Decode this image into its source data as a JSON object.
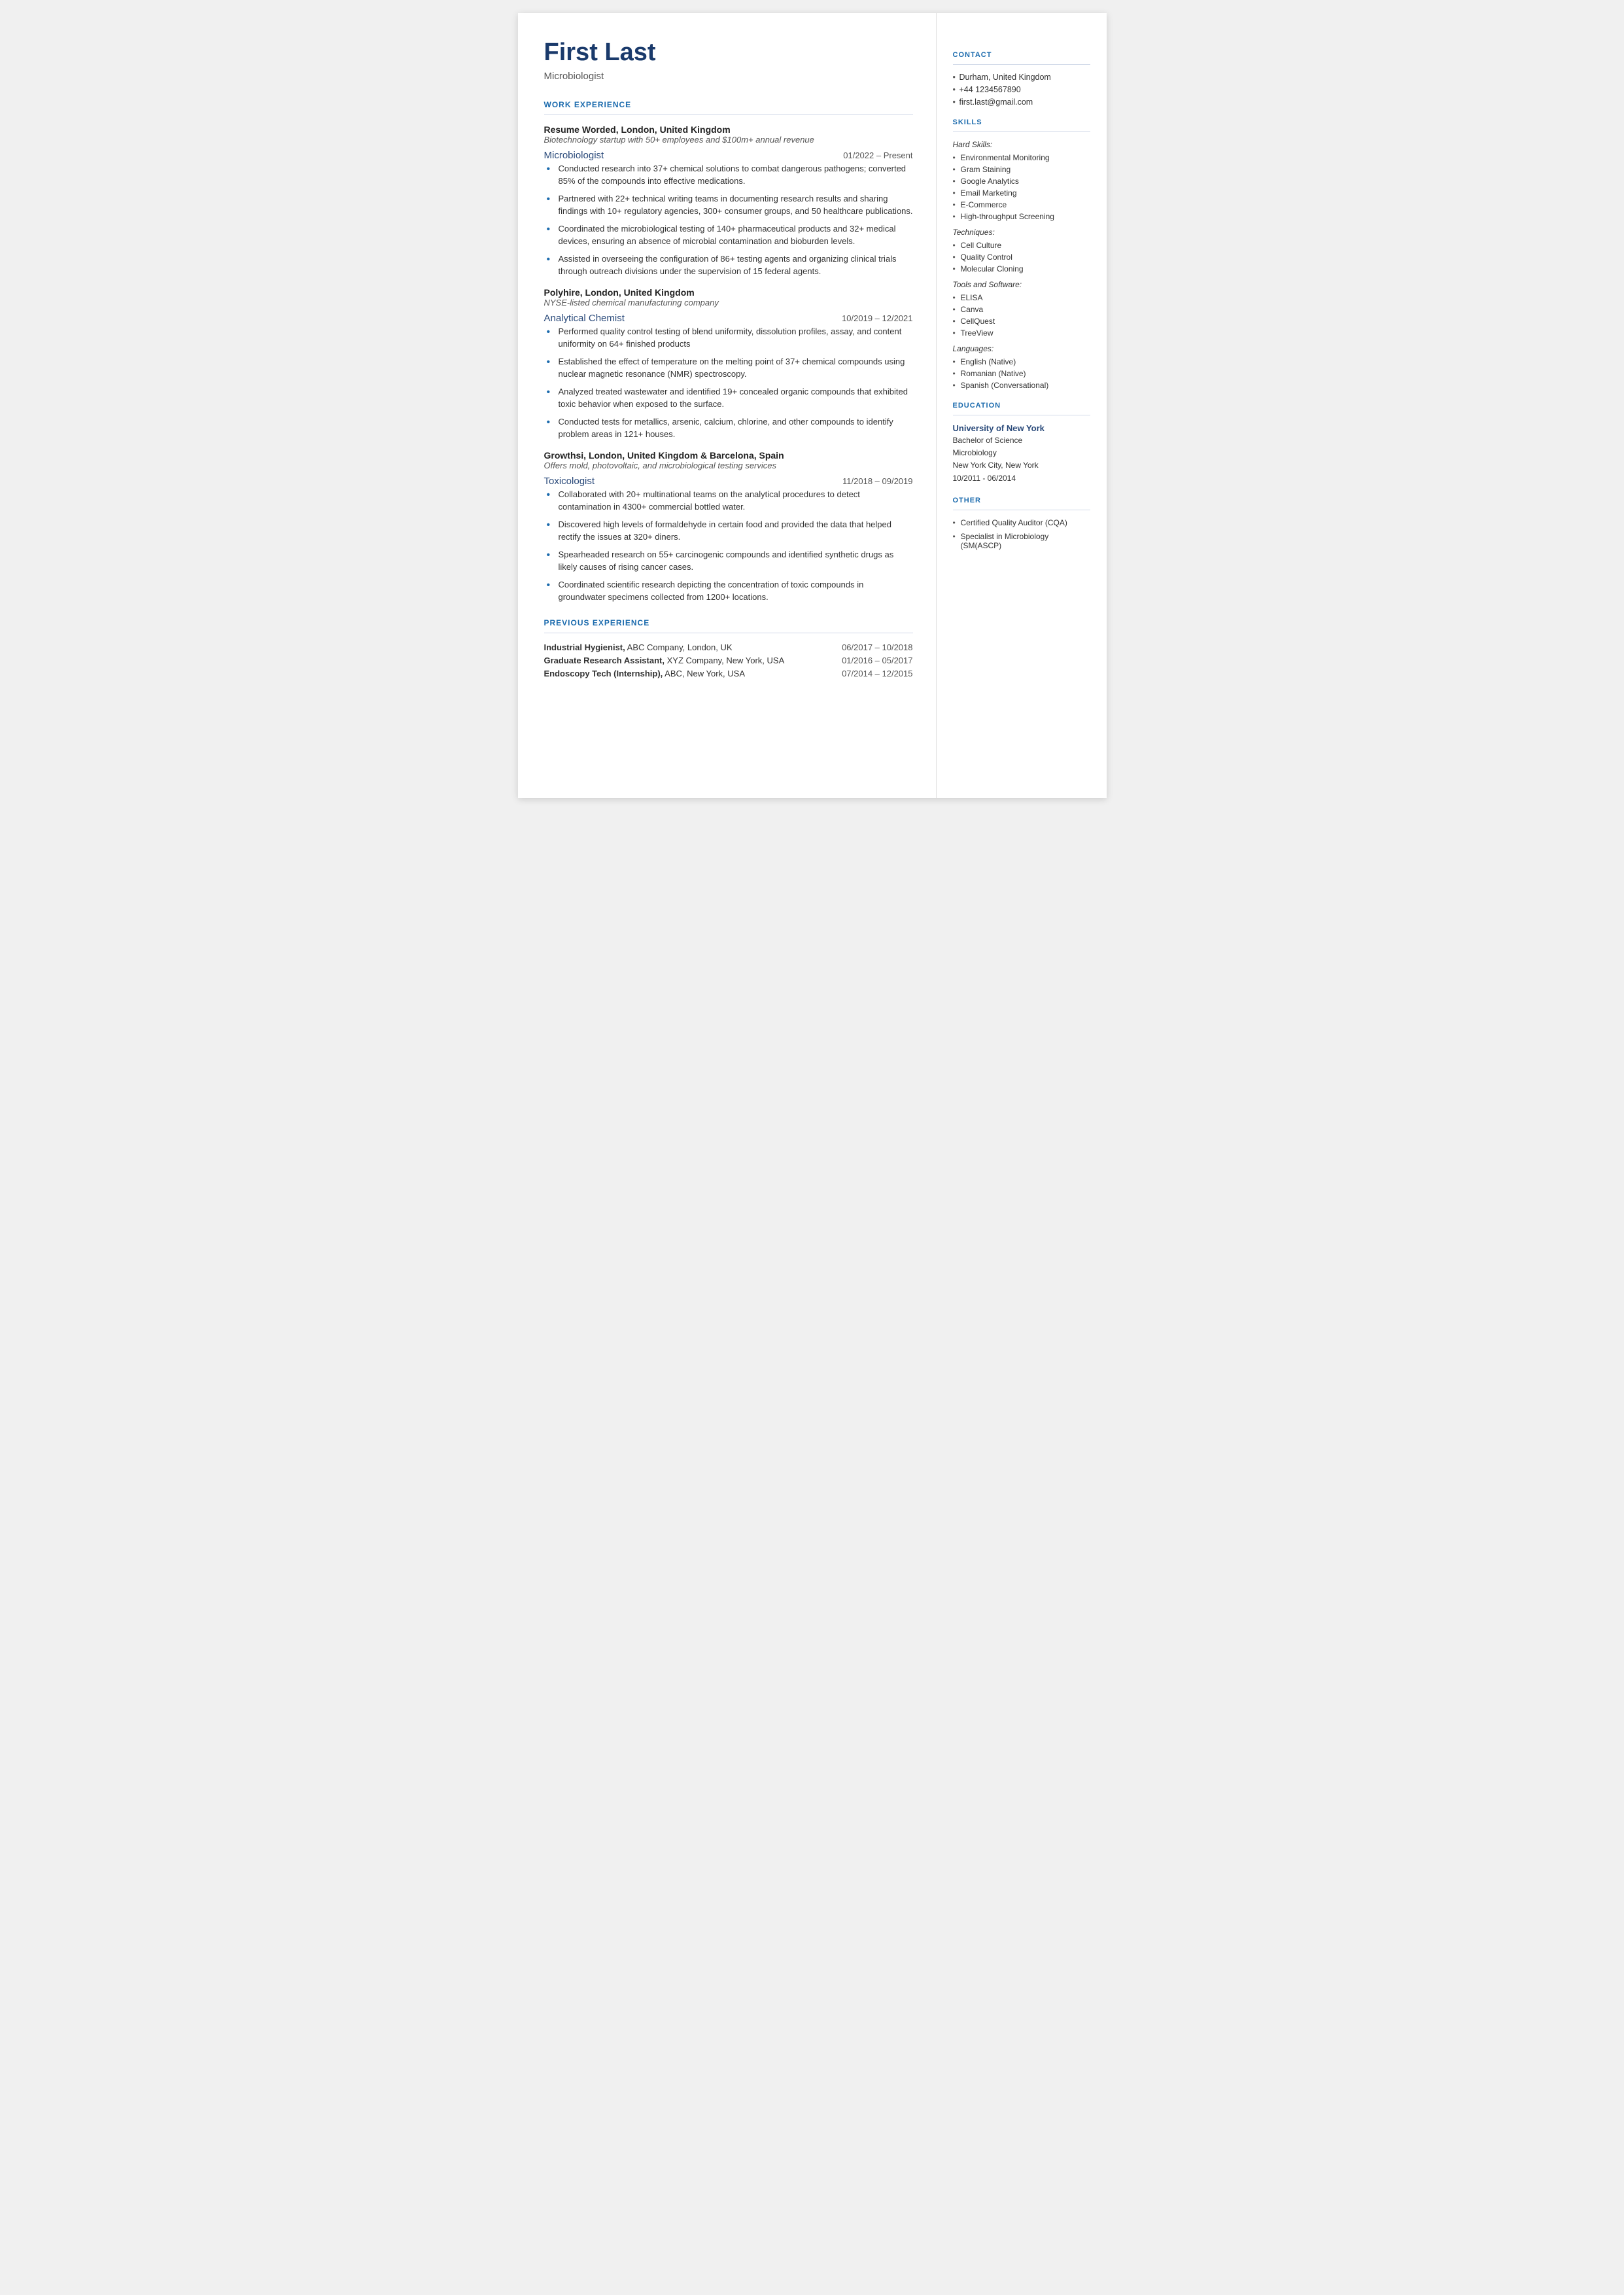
{
  "header": {
    "name": "First Last",
    "title": "Microbiologist"
  },
  "left": {
    "work_experience_heading": "WORK EXPERIENCE",
    "jobs": [
      {
        "employer": "Resume Worded,",
        "employer_suffix": " London, United Kingdom",
        "description": "Biotechnology startup with 50+ employees and $100m+ annual revenue",
        "job_title": "Microbiologist",
        "dates": "01/2022 – Present",
        "bullets": [
          "Conducted research into 37+ chemical solutions to combat dangerous pathogens; converted 85% of the compounds into effective medications.",
          "Partnered with 22+ technical writing teams in documenting research results and sharing findings with 10+ regulatory agencies, 300+ consumer groups, and 50 healthcare publications.",
          "Coordinated the microbiological testing of 140+ pharmaceutical products and 32+ medical devices, ensuring an absence of microbial contamination and bioburden levels.",
          "Assisted in overseeing the configuration of 86+ testing agents and organizing clinical trials through outreach divisions under the supervision of 15 federal agents."
        ]
      },
      {
        "employer": "Polyhire,",
        "employer_suffix": " London, United Kingdom",
        "description": "NYSE-listed chemical manufacturing company",
        "job_title": "Analytical Chemist",
        "dates": "10/2019 – 12/2021",
        "bullets": [
          "Performed quality control testing of blend uniformity, dissolution profiles, assay, and content uniformity on 64+ finished products",
          "Established the effect of temperature on the melting point of 37+ chemical compounds using nuclear magnetic resonance (NMR) spectroscopy.",
          "Analyzed treated wastewater and identified 19+ concealed organic compounds that exhibited toxic behavior when exposed to the surface.",
          "Conducted tests for metallics, arsenic, calcium, chlorine, and other compounds to identify problem areas in 121+ houses."
        ]
      },
      {
        "employer": "Growthsi,",
        "employer_suffix": " London, United Kingdom & Barcelona, Spain",
        "description": "Offers mold, photovoltaic, and microbiological testing services",
        "job_title": "Toxicologist",
        "dates": "11/2018 – 09/2019",
        "bullets": [
          "Collaborated with 20+ multinational teams on the analytical procedures to detect contamination in 4300+ commercial bottled water.",
          "Discovered high levels of formaldehyde in certain food and provided the data that helped rectify the issues at 320+ diners.",
          "Spearheaded research on 55+ carcinogenic compounds and identified synthetic drugs as likely causes of rising cancer cases.",
          "Coordinated scientific research depicting the concentration of toxic compounds in groundwater specimens collected from 1200+ locations."
        ]
      }
    ],
    "previous_experience_heading": "PREVIOUS EXPERIENCE",
    "previous_jobs": [
      {
        "label_bold": "Industrial Hygienist,",
        "label_normal": " ABC Company, London, UK",
        "dates": "06/2017 – 10/2018"
      },
      {
        "label_bold": "Graduate Research Assistant,",
        "label_normal": " XYZ Company, New York, USA",
        "dates": "01/2016 – 05/2017"
      },
      {
        "label_bold": "Endoscopy Tech (Internship),",
        "label_normal": " ABC, New York, USA",
        "dates": "07/2014 – 12/2015"
      }
    ]
  },
  "right": {
    "contact_heading": "CONTACT",
    "contact_items": [
      "Durham, United Kingdom",
      "+44 1234567890",
      "first.last@gmail.com"
    ],
    "skills_heading": "SKILLS",
    "hard_skills_label": "Hard Skills:",
    "hard_skills": [
      "Environmental Monitoring",
      "Gram Staining",
      "Google Analytics",
      "Email Marketing",
      "E-Commerce",
      "High-throughput Screening"
    ],
    "techniques_label": "Techniques:",
    "techniques": [
      "Cell Culture",
      "Quality Control",
      "Molecular Cloning"
    ],
    "tools_label": "Tools and Software:",
    "tools": [
      "ELISA",
      "Canva",
      "CellQuest",
      "TreeView"
    ],
    "languages_label": "Languages:",
    "languages": [
      "English (Native)",
      "Romanian (Native)",
      "Spanish (Conversational)"
    ],
    "education_heading": "EDUCATION",
    "education": {
      "school": "University of New York",
      "degree": "Bachelor of Science",
      "field": "Microbiology",
      "location": "New York City, New York",
      "dates": "10/2011 - 06/2014"
    },
    "other_heading": "OTHER",
    "other_items": [
      "Certified Quality Auditor (CQA)",
      "Specialist in Microbiology (SM(ASCP)"
    ]
  }
}
